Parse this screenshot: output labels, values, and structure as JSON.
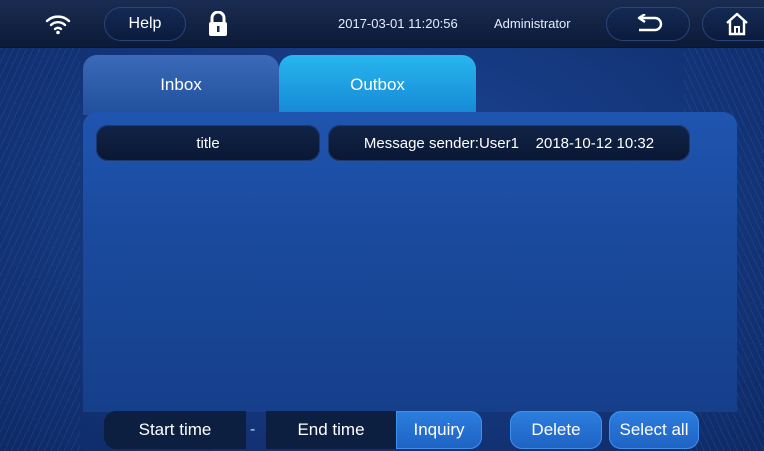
{
  "topbar": {
    "help_label": "Help",
    "datetime": "2017-03-01  11:20:56",
    "user": "Administrator",
    "icons": {
      "wifi": "wifi-icon",
      "lock": "lock-icon",
      "back": "back-arrow-icon",
      "home": "home-icon"
    }
  },
  "tabs": [
    {
      "label": "Inbox"
    },
    {
      "label": "Outbox"
    }
  ],
  "message_header": {
    "title_label": "title",
    "sender_info": "Message sender:User1    2018-10-12 10:32"
  },
  "bottom": {
    "start_time": "Start time",
    "separator": "-",
    "end_time": "End time",
    "inquiry": "Inquiry",
    "delete": "Delete",
    "select_all": "Select all"
  },
  "colors": {
    "background": "#163a82",
    "active_tab": "#1fa4e6",
    "button_blue": "#2670d4",
    "dark_field": "#0d1f40"
  }
}
